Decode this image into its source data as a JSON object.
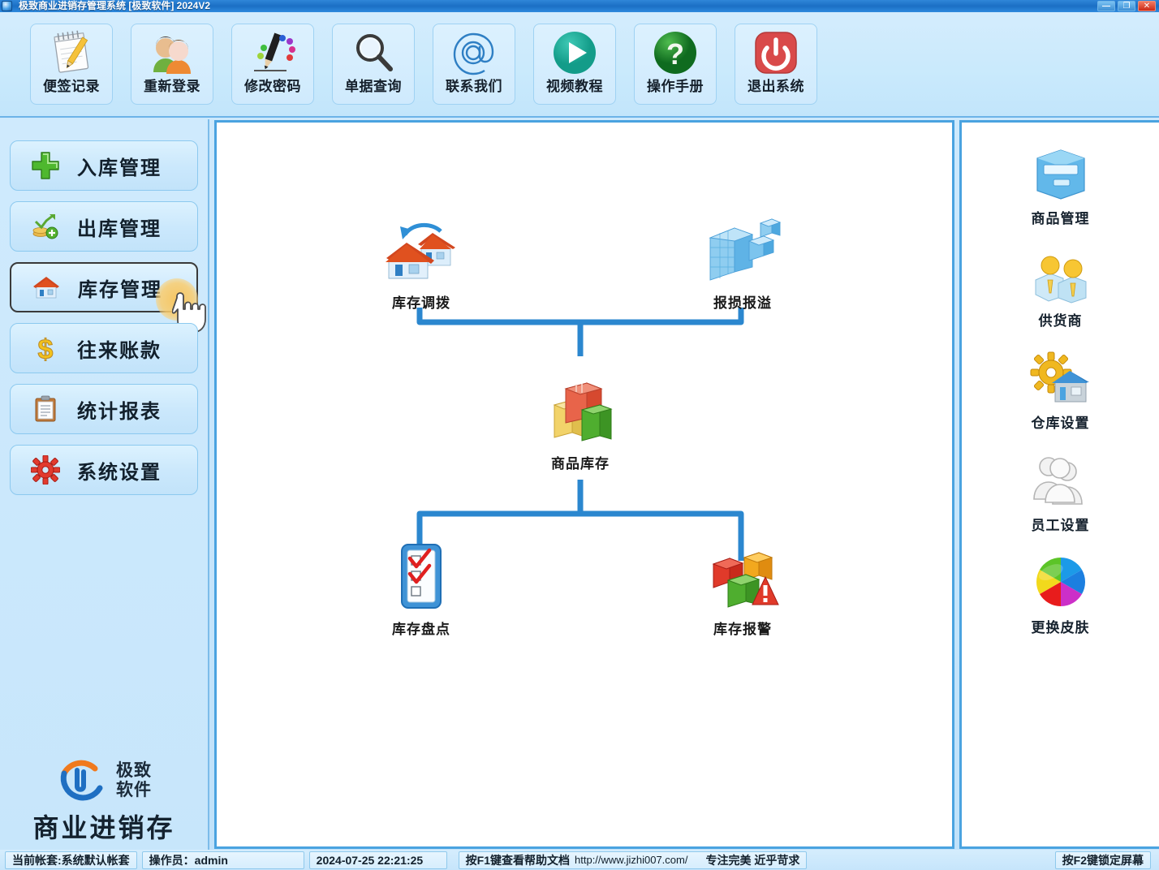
{
  "window": {
    "title": "极致商业进销存管理系统 [极致软件] 2024V2",
    "icon": "app-icon",
    "controls": [
      {
        "name": "minimize",
        "glyph": "—"
      },
      {
        "name": "maximize",
        "glyph": "❐"
      },
      {
        "name": "close",
        "glyph": "✕"
      }
    ]
  },
  "toolbar": {
    "items": [
      {
        "label": "便签记录",
        "icon": "notepad-pencil-icon"
      },
      {
        "label": "重新登录",
        "icon": "two-users-icon"
      },
      {
        "label": "修改密码",
        "icon": "pencil-palette-icon"
      },
      {
        "label": "单据查询",
        "icon": "magnifier-icon"
      },
      {
        "label": "联系我们",
        "icon": "at-sign-icon"
      },
      {
        "label": "视频教程",
        "icon": "play-circle-icon"
      },
      {
        "label": "操作手册",
        "icon": "question-circle-icon"
      },
      {
        "label": "退出系统",
        "icon": "power-off-icon"
      }
    ]
  },
  "sidebar": {
    "items": [
      {
        "label": "入库管理",
        "icon": "green-plus-icon",
        "selected": false
      },
      {
        "label": "出库管理",
        "icon": "money-chart-up-icon",
        "selected": false
      },
      {
        "label": "库存管理",
        "icon": "house-icon",
        "selected": true
      },
      {
        "label": "往来账款",
        "icon": "dollar-sign-icon",
        "selected": false
      },
      {
        "label": "统计报表",
        "icon": "clipboard-icon",
        "selected": false
      },
      {
        "label": "系统设置",
        "icon": "red-gear-icon",
        "selected": false
      }
    ],
    "logo": {
      "mark": "jizhi-logo-mark",
      "line1": "极致",
      "line2": "软件",
      "main": "商业进销存"
    }
  },
  "main": {
    "nodes": [
      {
        "id": "transfer",
        "label": "库存调拨",
        "icon": "two-houses-arrow-icon"
      },
      {
        "id": "lossgain",
        "label": "报损报溢",
        "icon": "blue-blocks-icon"
      },
      {
        "id": "stock",
        "label": "商品库存",
        "icon": "colored-boxes-icon"
      },
      {
        "id": "count",
        "label": "库存盘点",
        "icon": "checklist-clipboard-icon"
      },
      {
        "id": "alert",
        "label": "库存报警",
        "icon": "cubes-warning-icon"
      }
    ],
    "connector_color": "#2b87cf"
  },
  "right_panel": {
    "items": [
      {
        "label": "商品管理",
        "icon": "blue-drawer-icon"
      },
      {
        "label": "供货商",
        "icon": "two-persons-tie-icon"
      },
      {
        "label": "仓库设置",
        "icon": "gear-warehouse-icon"
      },
      {
        "label": "员工设置",
        "icon": "grey-people-icon"
      },
      {
        "label": "更换皮肤",
        "icon": "color-wheel-icon"
      }
    ]
  },
  "statusbar": {
    "account": "当前帐套:系统默认帐套",
    "operator": "操作员：admin",
    "datetime": "2024-07-25 22:21:25",
    "help": "按F1键查看帮助文档",
    "url": "http://www.jizhi007.com/",
    "slogan": "专注完美 近乎苛求",
    "lock": "按F2键锁定屏幕"
  },
  "colors": {
    "titlebar": "#1b6fc4",
    "panel_bg": "#cfeafd",
    "accent_border": "#4aa3e0",
    "connector": "#2b87cf"
  }
}
